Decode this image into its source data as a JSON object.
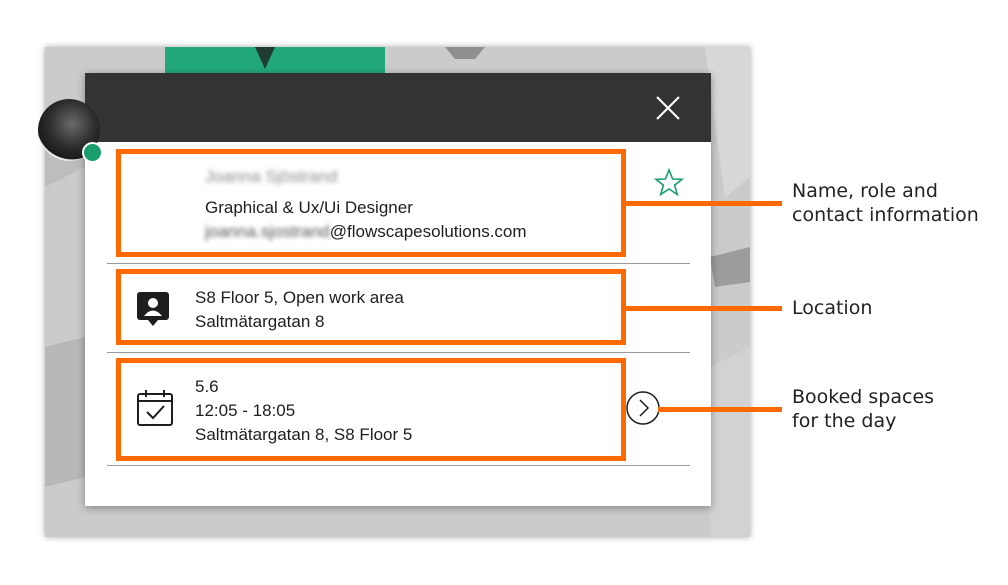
{
  "popup": {
    "person": {
      "name": "Joanna Sjöstrand",
      "role": "Graphical & Ux/Ui Designer",
      "email_user": "joanna.sjostrand",
      "email_domain": "@flowscapesolutions.com",
      "status": "online"
    },
    "location": {
      "line1": "S8 Floor 5, Open work area",
      "line2": "Saltmätargatan 8"
    },
    "booking": {
      "date": "5.6",
      "time": "12:05 - 18:05",
      "place": "Saltmätargatan 8, S8 Floor 5"
    }
  },
  "annotations": {
    "name_info": "Name, role and contact information",
    "location": "Location",
    "booked": "Booked spaces for the day"
  },
  "colors": {
    "header": "#333333",
    "accent_green": "#1a9e6e",
    "annotation_orange": "#ff6a00"
  }
}
